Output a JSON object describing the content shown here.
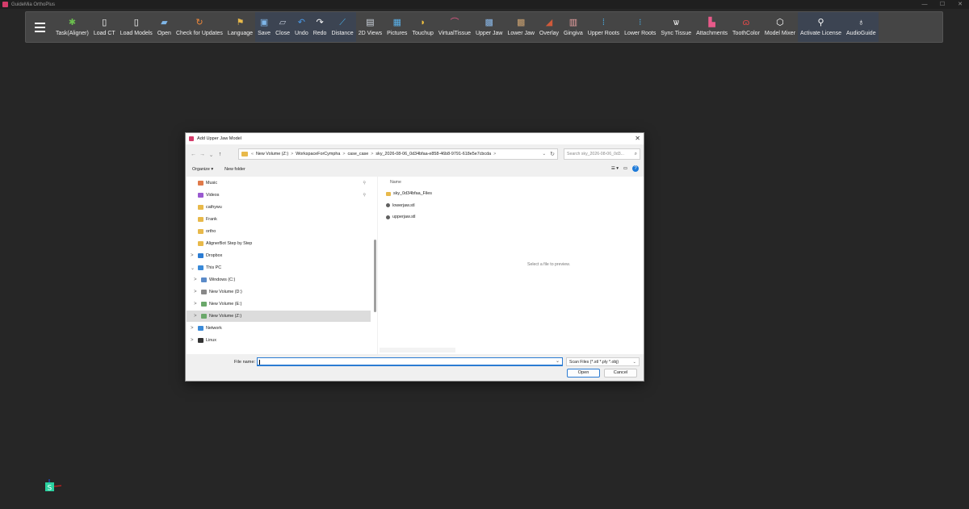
{
  "app": {
    "title": "GuideMia OrthoPlus",
    "window_controls": [
      "—",
      "☐",
      "✕"
    ]
  },
  "toolbar": {
    "menu_icon": "hamburger-icon",
    "items_main": [
      {
        "label": "Task(Aligner)",
        "icon": "gear-icon",
        "color": "#6bbf4e",
        "glyph": "✱"
      },
      {
        "label": "Load CT",
        "icon": "document-icon",
        "color": "#ffffff",
        "glyph": "▯"
      },
      {
        "label": "Load Models",
        "icon": "document-icon",
        "color": "#ffffff",
        "glyph": "▯"
      },
      {
        "label": "Open",
        "icon": "open-folder-icon",
        "color": "#7fb6e8",
        "glyph": "▰"
      },
      {
        "label": "Check for Updates",
        "icon": "refresh-icon",
        "color": "#f0883a",
        "glyph": "↻"
      },
      {
        "label": "Language",
        "icon": "language-icon",
        "color": "#e8b94a",
        "glyph": "⚑"
      }
    ],
    "items_edit": [
      {
        "label": "Save",
        "icon": "save-icon",
        "color": "#7fb6e8",
        "glyph": "▣"
      },
      {
        "label": "Close",
        "icon": "close-doc-icon",
        "color": "#c0c8d6",
        "glyph": "▱"
      },
      {
        "label": "Undo",
        "icon": "undo-icon",
        "color": "#4a9ae8",
        "glyph": "↶"
      },
      {
        "label": "Redo",
        "icon": "redo-icon",
        "color": "#ffffff",
        "glyph": "↷"
      },
      {
        "label": "Distance",
        "icon": "ruler-icon",
        "color": "#4ab0e8",
        "glyph": "⟋"
      }
    ],
    "items_view": [
      {
        "label": "2D Views",
        "icon": "views-icon",
        "color": "#cfd6e0",
        "glyph": "▤"
      },
      {
        "label": "Pictures",
        "icon": "pictures-icon",
        "color": "#5ab0e8",
        "glyph": "▦"
      },
      {
        "label": "Touchup",
        "icon": "touchup-icon",
        "color": "#f0c040",
        "glyph": "◗"
      },
      {
        "label": "VirtualTissue",
        "icon": "tissue-icon",
        "color": "#e85a8a",
        "glyph": "⌒"
      },
      {
        "label": "Upper Jaw",
        "icon": "upper-jaw-icon",
        "color": "#8ab8e8",
        "glyph": "▩"
      },
      {
        "label": "Lower Jaw",
        "icon": "lower-jaw-icon",
        "color": "#c8a070",
        "glyph": "▩"
      },
      {
        "label": "Overlay",
        "icon": "overlay-icon",
        "color": "#d05a3a",
        "glyph": "◢"
      },
      {
        "label": "Gingiva",
        "icon": "gingiva-icon",
        "color": "#e8a0a0",
        "glyph": "▥"
      },
      {
        "label": "Upper Roots",
        "icon": "upper-roots-icon",
        "color": "#4ab0e8",
        "glyph": "⁞"
      },
      {
        "label": "Lower Roots",
        "icon": "lower-roots-icon",
        "color": "#4ab0e8",
        "glyph": "⁝"
      },
      {
        "label": "Sync Tissue",
        "icon": "sync-tissue-icon",
        "color": "#ffffff",
        "glyph": "ѡ"
      },
      {
        "label": "Attachments",
        "icon": "attachments-icon",
        "color": "#e85a8a",
        "glyph": "▙"
      },
      {
        "label": "ToothColor",
        "icon": "tooth-color-icon",
        "color": "#e84a4a",
        "glyph": "ɷ"
      },
      {
        "label": "Model Mixer",
        "icon": "cube-icon",
        "color": "#ffffff",
        "glyph": "⬡"
      }
    ],
    "items_right": [
      {
        "label": "Activate License",
        "icon": "key-icon",
        "color": "#ffffff",
        "glyph": "⚲"
      },
      {
        "label": "AudioGuide",
        "icon": "mic-off-icon",
        "color": "#ffffff",
        "glyph": "♁"
      }
    ]
  },
  "axis_widget": {
    "letter": "S",
    "color": "#2bd1a0"
  },
  "dialog": {
    "title": "Add Upper Jaw Model",
    "close": "✕",
    "nav": {
      "back": "←",
      "forward": "→",
      "recent": "⌄",
      "up": "↑"
    },
    "address": {
      "lead": "«",
      "segments": [
        "New Volume (Z:)",
        "WorkspaceForCympha",
        "case_case",
        "sky_2026-08-06_0d34bfaa-e858-46b8-9791-618e5e7cbcda"
      ],
      "separator": ">",
      "dropdown": "⌄",
      "refresh": "↻"
    },
    "search_placeholder": "Search sky_2026-08-06_0d3...",
    "search_icon": "⌕",
    "commands": {
      "organize": "Organize ▾",
      "new_folder": "New folder",
      "view": "☰ ▾",
      "pane": "▭",
      "help": "?"
    },
    "nav_items": [
      {
        "label": "Music",
        "icon": "music-icon",
        "color": "#e07a4a",
        "pinned": true,
        "expand": ""
      },
      {
        "label": "Videos",
        "icon": "videos-icon",
        "color": "#9a5ad0",
        "pinned": true,
        "expand": ""
      },
      {
        "label": "cathywu",
        "icon": "folder-icon",
        "color": "#e8b94a",
        "pinned": false,
        "expand": ""
      },
      {
        "label": "Frank",
        "icon": "folder-icon",
        "color": "#e8b94a",
        "pinned": false,
        "expand": ""
      },
      {
        "label": "ortho",
        "icon": "folder-icon",
        "color": "#e8b94a",
        "pinned": false,
        "expand": ""
      },
      {
        "label": "AlignerBot Step by Step",
        "icon": "folder-icon",
        "color": "#e8b94a",
        "pinned": false,
        "expand": ""
      },
      {
        "label": "Dropbox",
        "icon": "dropbox-icon",
        "color": "#2b7cd3",
        "pinned": false,
        "expand": ">"
      },
      {
        "label": "This PC",
        "icon": "pc-icon",
        "color": "#3a8ad8",
        "pinned": false,
        "expand": "⌄"
      },
      {
        "label": "Windows (C:)",
        "icon": "drive-icon",
        "color": "#5a8ac8",
        "pinned": false,
        "expand": ">"
      },
      {
        "label": "New Volume (D:)",
        "icon": "drive-icon",
        "color": "#888888",
        "pinned": false,
        "expand": ">"
      },
      {
        "label": "New Volume (E:)",
        "icon": "drive-icon",
        "color": "#6aa86a",
        "pinned": false,
        "expand": ">"
      },
      {
        "label": "New Volume (Z:)",
        "icon": "drive-icon",
        "color": "#6aa86a",
        "pinned": false,
        "expand": ">",
        "selected": true
      },
      {
        "label": "Network",
        "icon": "network-icon",
        "color": "#3a8ad8",
        "pinned": false,
        "expand": ">"
      },
      {
        "label": "Linux",
        "icon": "linux-icon",
        "color": "#333333",
        "pinned": false,
        "expand": ">"
      }
    ],
    "pin_glyph": "⚲",
    "file_column": "Name",
    "files": [
      {
        "name": "sky_0d34bfaa_Files",
        "icon": "folder-icon",
        "color": "#e8b94a"
      },
      {
        "name": "lowerjaw.stl",
        "icon": "stl-file-icon",
        "color": "#606060"
      },
      {
        "name": "upperjaw.stl",
        "icon": "stl-file-icon",
        "color": "#606060"
      }
    ],
    "preview_text": "Select a file to preview.",
    "file_name_label": "File name:",
    "file_name_value": "",
    "file_type": "Scan Files (*.stl *.ply *.obj)",
    "open_label": "Open",
    "cancel_label": "Cancel"
  }
}
